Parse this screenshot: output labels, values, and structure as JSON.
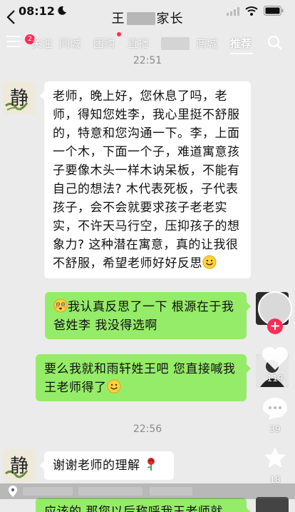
{
  "status_bar": {
    "time": "08:12"
  },
  "header": {
    "title_prefix": "王",
    "title_suffix": "家长"
  },
  "tabs": {
    "badge": "2",
    "items": [
      "关注",
      "同城",
      "团购",
      "直播",
      "商城",
      "推荐"
    ],
    "active": "推荐"
  },
  "timestamps": [
    "22:51",
    "22:56"
  ],
  "avatar_glyph": "静",
  "messages": {
    "teacher_long": "老师，晚上好，您休息了吗，老师，得知您姓李，我心里挺不舒服的，特意和您沟通一下。李，上面一个木，下面一个子，难道寓意孩子要像木头一样木讷呆板，不能有自己的想法? 木代表死板，子代表孩子，会不会就要求孩子老老实实，不许天马行空，压抑孩子的想象力? 这种潜在寓意，真的让我很不舒服，希望老师好好反思",
    "reply_1": "我认真反思了一下 根源在于我爸姓李 我没得选啊",
    "reply_2": "要么我就和雨轩姓王吧 您直接喊我王老师得了",
    "thanks": "谢谢老师的理解",
    "reply_3": "应该的 那您以后称呼我王老师就"
  },
  "rail": {
    "like_count": "119",
    "comment_count": "39",
    "fav_count": "18"
  },
  "colors": {
    "bubble_green": "#95ec69",
    "accent_red": "#fe2c55",
    "background": "#ebebeb"
  }
}
